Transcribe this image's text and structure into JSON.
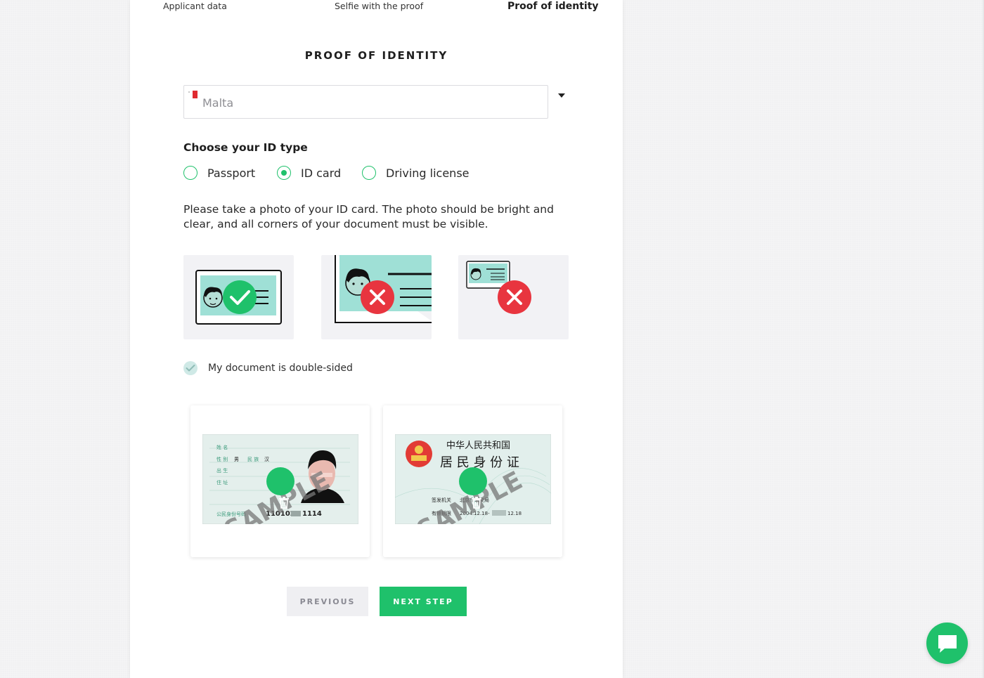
{
  "stepper": {
    "steps": [
      "Applicant data",
      "Selfie with the proof",
      "Proof of identity"
    ],
    "active": 2
  },
  "page_title": "PROOF OF IDENTITY",
  "country": {
    "value": "Malta",
    "flag_icon": "malta-flag-icon"
  },
  "id_type": {
    "label": "Choose your ID type",
    "options": [
      "Passport",
      "ID card",
      "Driving license"
    ],
    "selected": "ID card"
  },
  "instructions": "Please take a photo of your ID card. The photo should be bright and clear, and all corners of your document must be visible.",
  "examples": [
    {
      "name": "correct-example",
      "status_icon": "check-icon"
    },
    {
      "name": "cropped-example",
      "status_icon": "x-icon"
    },
    {
      "name": "too-small-example",
      "status_icon": "x-icon"
    }
  ],
  "double_sided": {
    "label": "My document is double-sided",
    "checked": true
  },
  "uploads": {
    "front": {
      "watermark": "SAMPLE",
      "id_number": "110102",
      "id_number_end": "1114"
    },
    "back": {
      "watermark": "SAMPLE",
      "header_line1": "中华人民共和国",
      "header_line2": "居 民 身 份 证",
      "authority_label": "签发机关",
      "authority_value": "北京市公安局",
      "validity_label": "有效期限",
      "validity_value": "2004.12.18-",
      "validity_end": "12.18"
    }
  },
  "buttons": {
    "previous": "PREVIOUS",
    "next": "NEXT STEP"
  },
  "colors": {
    "accent": "#1fc16b",
    "error": "#e8353f",
    "card_teal": "#9fe0d6"
  }
}
